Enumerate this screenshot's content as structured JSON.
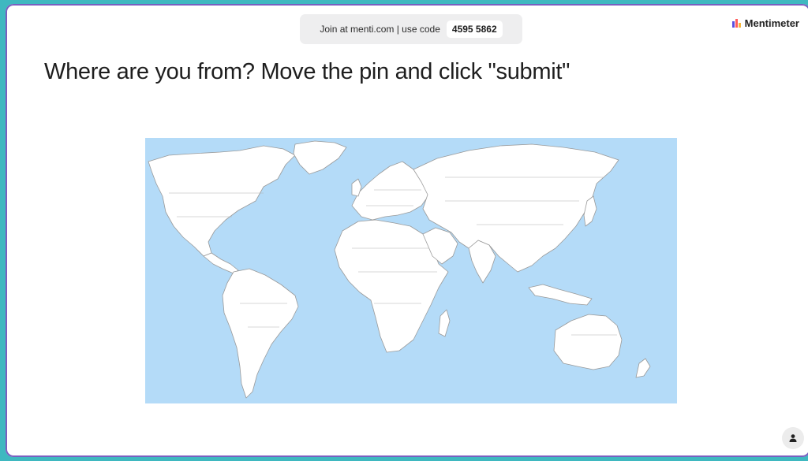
{
  "join_banner": {
    "text": "Join at menti.com | use code",
    "code": "4595 5862"
  },
  "brand": {
    "name": "Mentimeter",
    "icon": "mentimeter-logo-icon"
  },
  "question": {
    "title": "Where are you from? Move the pin and click \"submit\""
  },
  "map": {
    "type": "world-map",
    "ocean_color": "#b4dbf8",
    "land_color": "#ffffff"
  },
  "participant_button": {
    "icon": "person-icon"
  },
  "colors": {
    "frame": "#3fb8c0",
    "frame_border": "#7a5fc0",
    "slide": "#ffffff"
  }
}
